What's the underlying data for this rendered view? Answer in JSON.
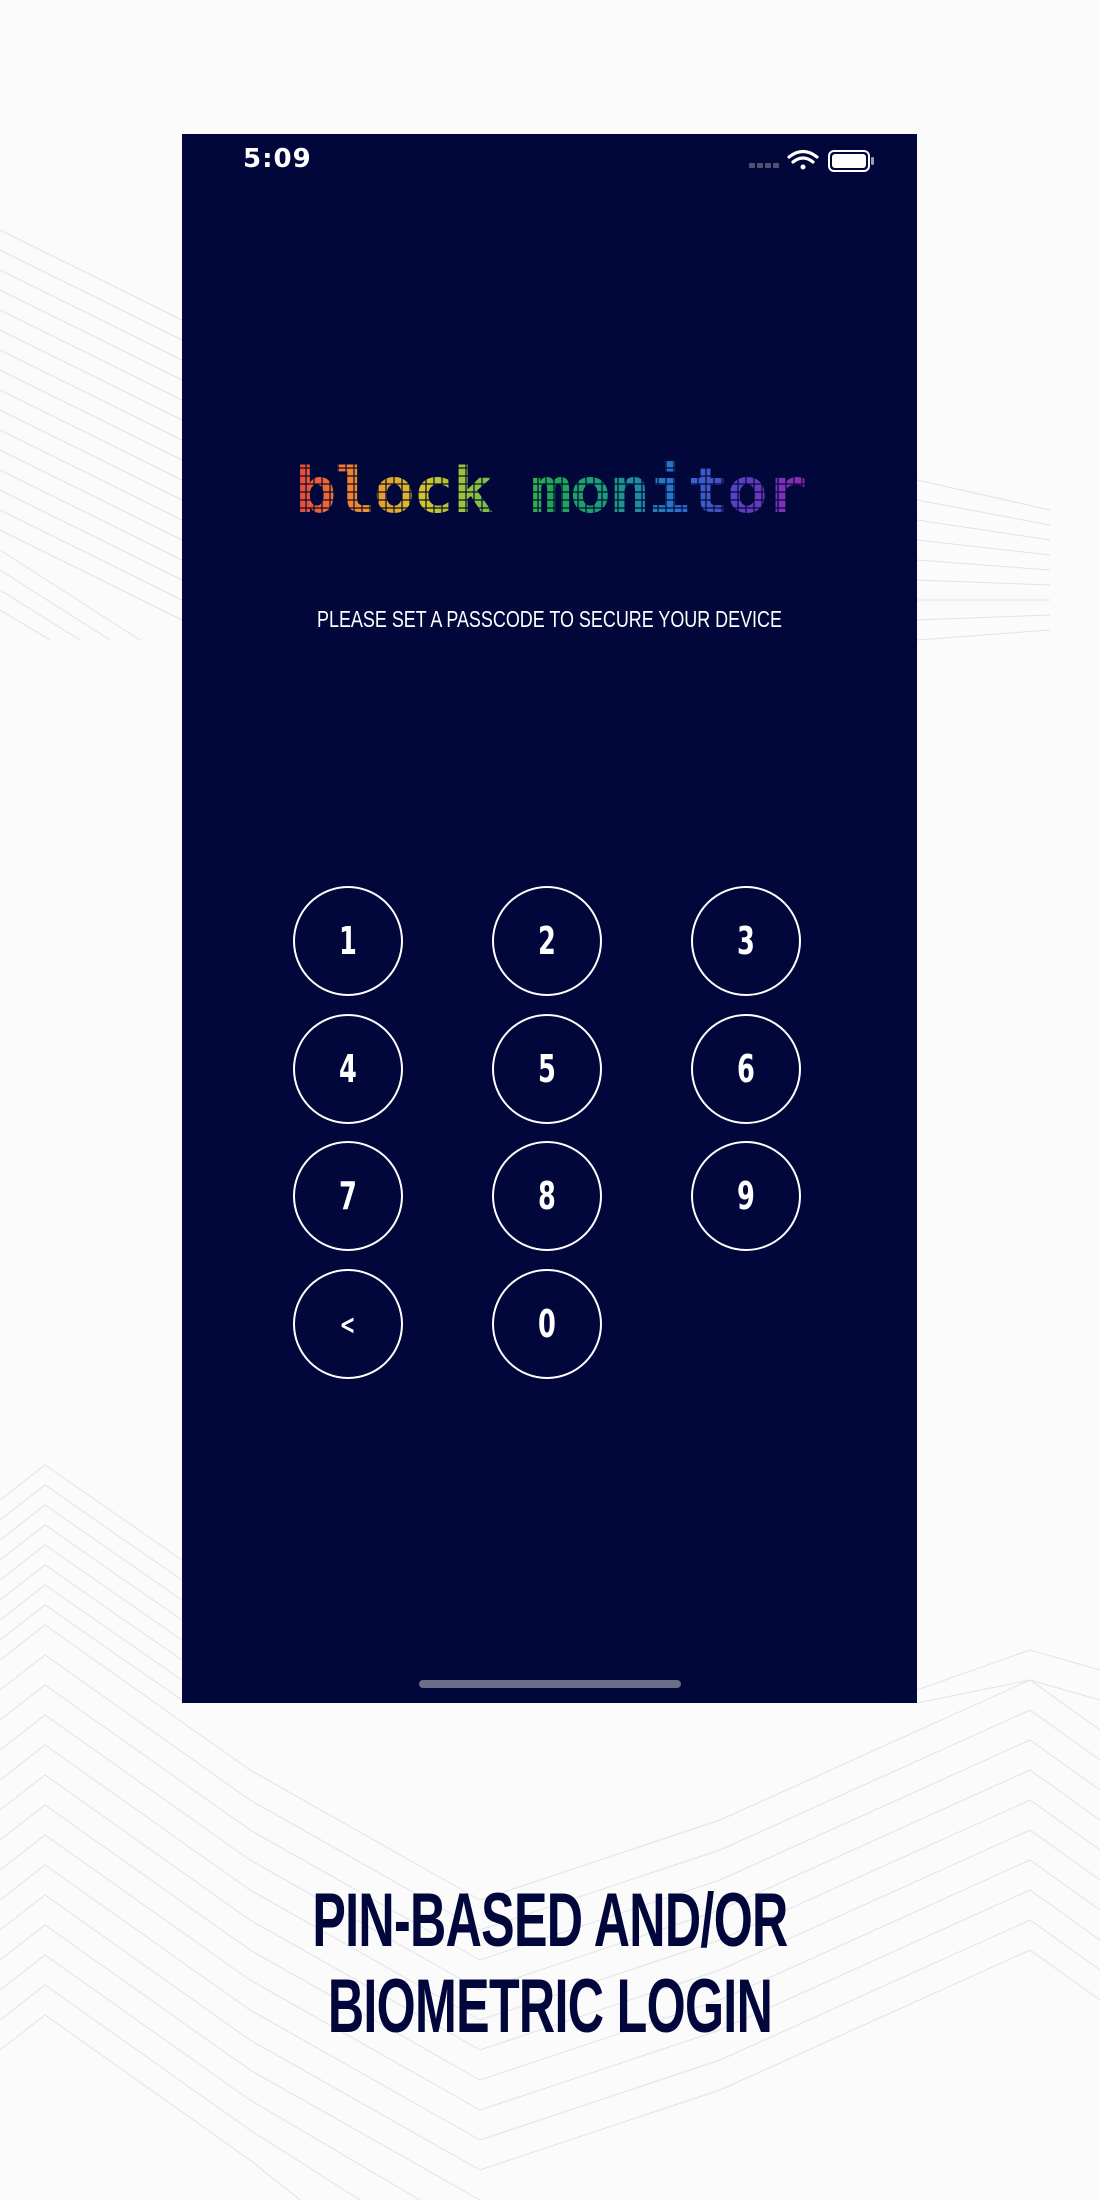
{
  "status_bar": {
    "time": "5:09",
    "icons": [
      "signal-dots-icon",
      "wifi-icon",
      "battery-icon"
    ]
  },
  "app": {
    "logo_text": "block monitor",
    "prompt": "PLEASE SET A PASSCODE TO SECURE YOUR DEVICE",
    "background_color": "#01073a",
    "logo_colors": [
      "#e8473a",
      "#f28c28",
      "#d6c52a",
      "#7cc043",
      "#1fa84f",
      "#1b9c80",
      "#2a6fd1",
      "#5a3fc0",
      "#8b2bb0"
    ]
  },
  "keypad": {
    "keys": [
      {
        "label": "1"
      },
      {
        "label": "2"
      },
      {
        "label": "3"
      },
      {
        "label": "4"
      },
      {
        "label": "5"
      },
      {
        "label": "6"
      },
      {
        "label": "7"
      },
      {
        "label": "8"
      },
      {
        "label": "9"
      },
      {
        "label": "<"
      },
      {
        "label": "0"
      }
    ]
  },
  "caption": {
    "line1": "PIN-BASED AND/OR",
    "line2": "BIOMETRIC LOGIN"
  }
}
